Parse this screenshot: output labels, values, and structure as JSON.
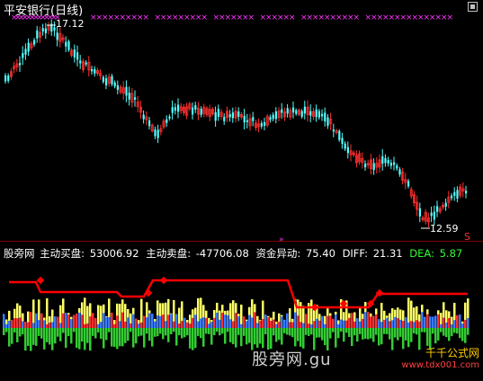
{
  "header": {
    "title": "平安银行(日线)"
  },
  "price_chart": {
    "high_label": "17.12",
    "low_label": "12.59",
    "s_mark": "S",
    "arrow_mark": "»"
  },
  "indicator": {
    "name": "股旁网",
    "items": [
      {
        "label": "主动买盘:",
        "value": "53006.92",
        "color": "#ffffff"
      },
      {
        "label": "主动卖盘:",
        "value": "-47706.08",
        "color": "#ffffff"
      },
      {
        "label": "资金异动:",
        "value": "75.40",
        "color": "#ffffff"
      },
      {
        "label": "DIFF:",
        "value": "21.31",
        "color": "#ffffff"
      },
      {
        "label": "DEA:",
        "value": "5.87",
        "color": "#33ff33"
      }
    ]
  },
  "watermark": {
    "text": "股旁网.gu"
  },
  "brand": {
    "name": "千千公式网",
    "url": "www.tdx001.com"
  },
  "colors": {
    "up_candle": "#ff3030",
    "down_candle": "#54ffff",
    "background": "#000000",
    "marker": "#ff33ff",
    "step_line": "#ff0000",
    "yellow": "#ffff66",
    "green": "#33cc33",
    "blue": "#3a7dff"
  }
}
